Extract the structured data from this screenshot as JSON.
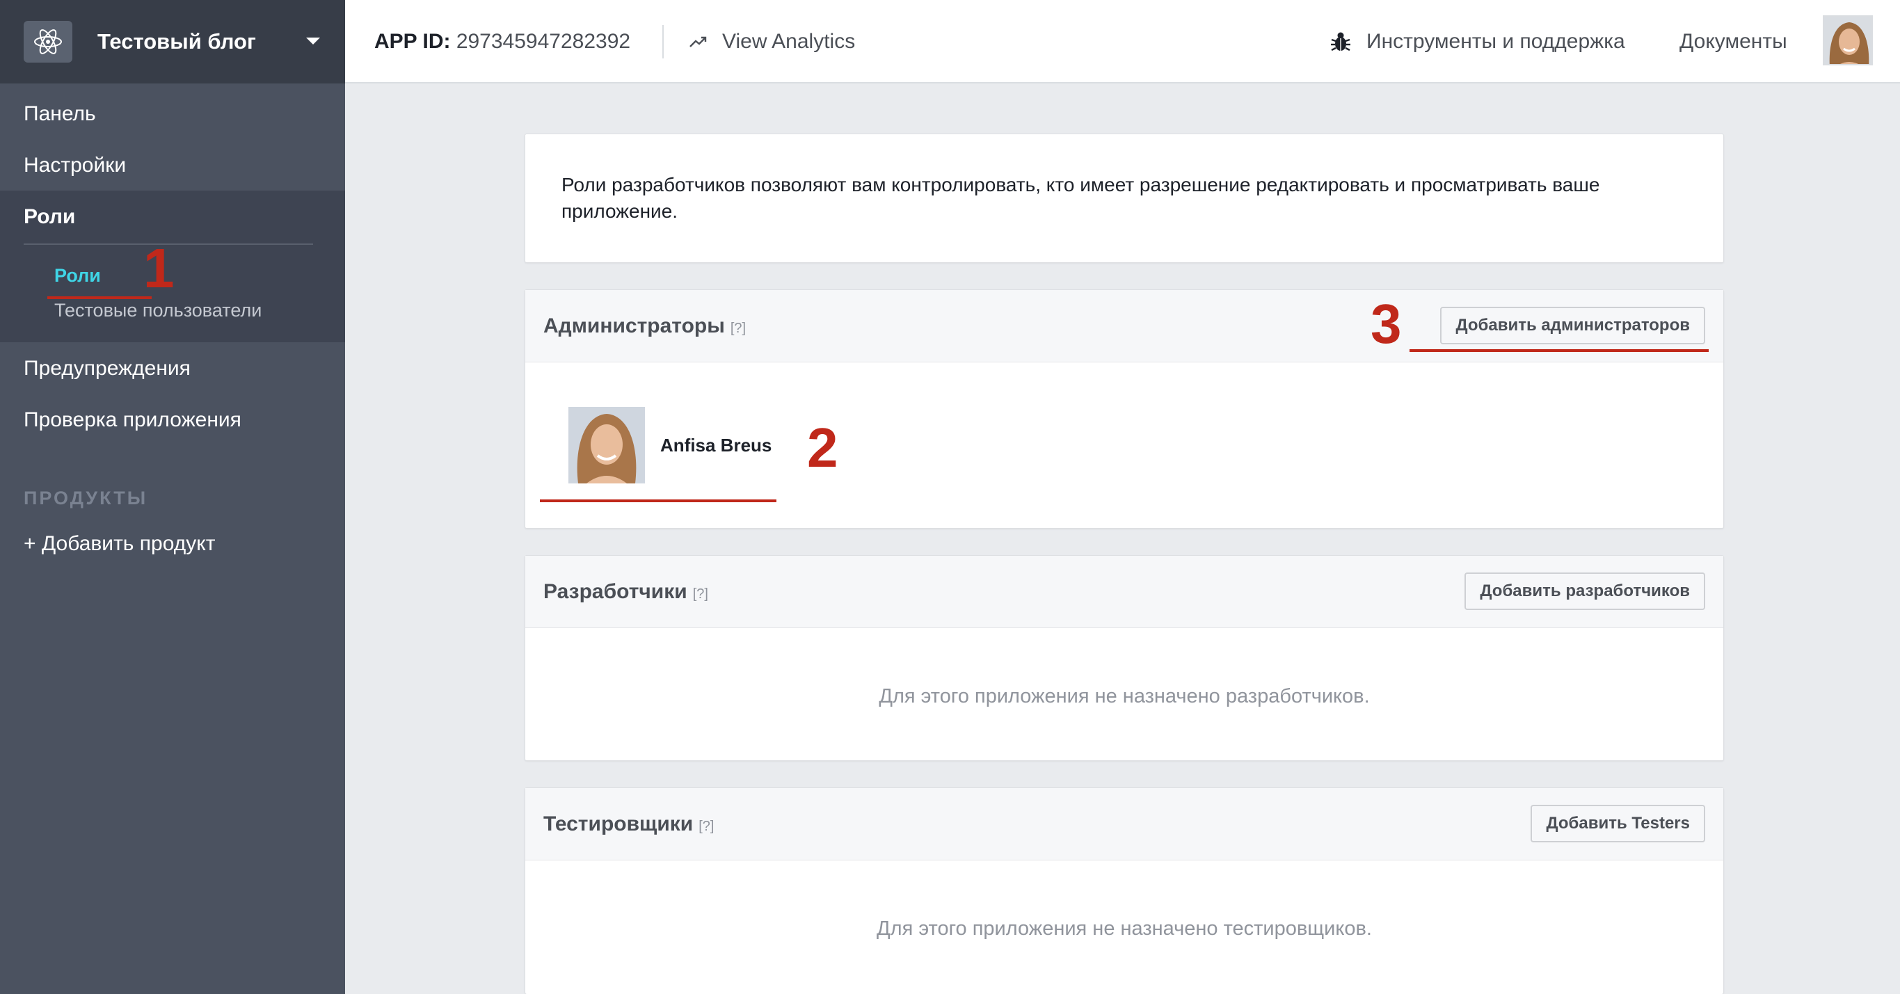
{
  "sidebar": {
    "app_name": "Тестовый блог",
    "items": [
      {
        "label": "Панель"
      },
      {
        "label": "Настройки"
      },
      {
        "label": "Роли"
      },
      {
        "label": "Предупреждения"
      },
      {
        "label": "Проверка приложения"
      }
    ],
    "sub_items": [
      {
        "label": "Роли"
      },
      {
        "label": "Тестовые пользователи"
      }
    ],
    "products_heading": "ПРОДУКТЫ",
    "add_product": "+ Добавить продукт"
  },
  "topbar": {
    "app_id_label": "APP ID:",
    "app_id_value": "297345947282392",
    "analytics": "View Analytics",
    "tools": "Инструменты и поддержка",
    "docs": "Документы"
  },
  "intro": {
    "text": "Роли разработчиков позволяют вам контролировать, кто имеет разрешение редактировать и просматривать ваше приложение."
  },
  "panels": {
    "admins": {
      "title": "Администраторы",
      "help": "[?]",
      "button": "Добавить администраторов",
      "users": [
        {
          "name": "Anfisa Breus"
        }
      ]
    },
    "developers": {
      "title": "Разработчики",
      "help": "[?]",
      "button": "Добавить разработчиков",
      "empty": "Для этого приложения не назначено разработчиков."
    },
    "testers": {
      "title": "Тестировщики",
      "help": "[?]",
      "button": "Добавить Testers",
      "empty": "Для этого приложения не назначено тестировщиков."
    }
  },
  "annotations": {
    "one": "1",
    "two": "2",
    "three": "3",
    "color": "#c0281a"
  },
  "colors": {
    "sidebar_bg": "#4b5260",
    "sidebar_active_bg": "#3e4452",
    "active_sub_item": "#3fd5e6"
  }
}
